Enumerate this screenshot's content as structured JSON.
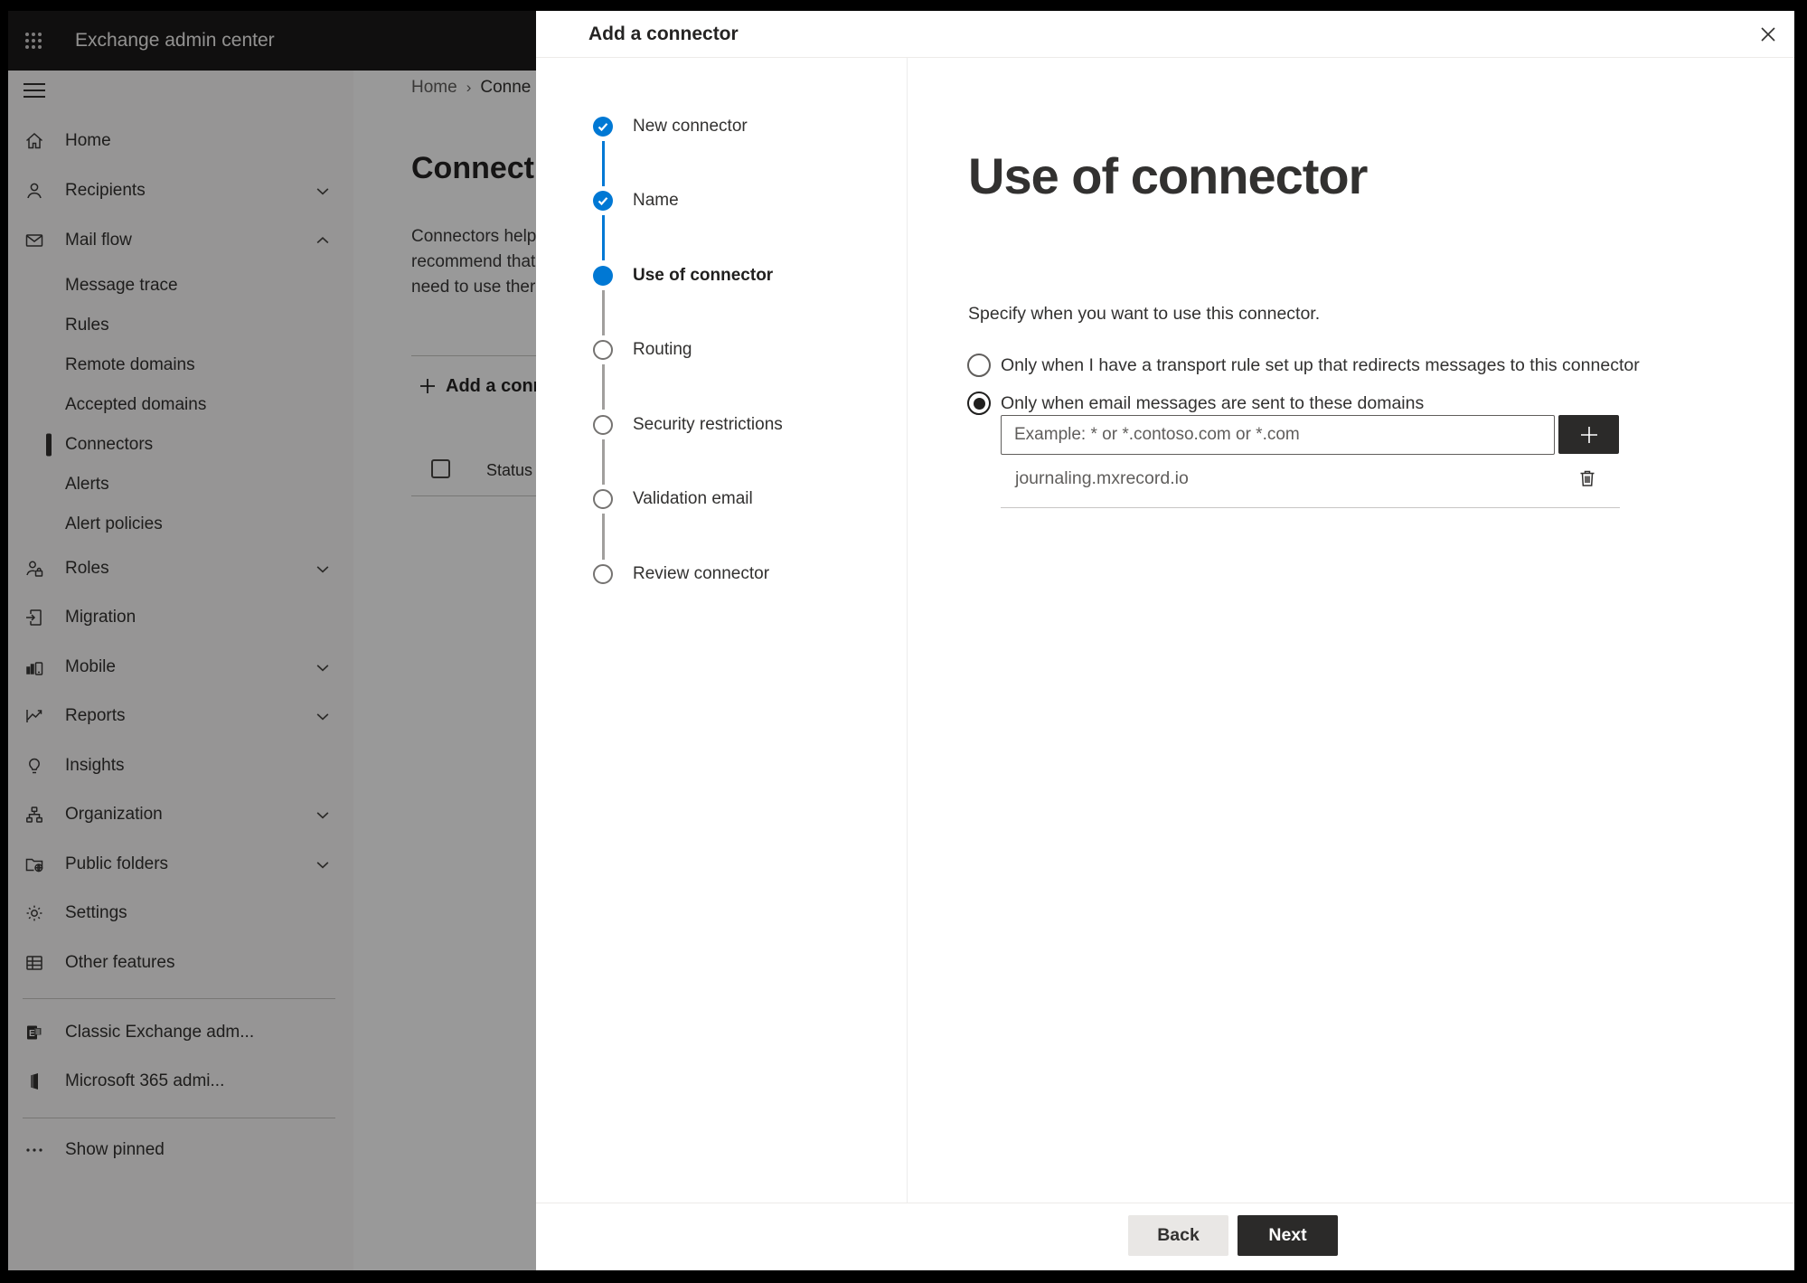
{
  "topbar": {
    "title": "Exchange admin center",
    "waffle_icon": "app-launcher-waffle-icon"
  },
  "sidebar": {
    "hamburger_icon": "hamburger-menu-icon",
    "items": [
      {
        "label": "Home",
        "icon": "home-icon",
        "type": "main"
      },
      {
        "label": "Recipients",
        "icon": "person-icon",
        "type": "main",
        "chevron": "down"
      },
      {
        "label": "Mail flow",
        "icon": "mail-icon",
        "type": "main",
        "chevron": "up",
        "expanded": true
      },
      {
        "label": "Message trace",
        "type": "sub"
      },
      {
        "label": "Rules",
        "type": "sub"
      },
      {
        "label": "Remote domains",
        "type": "sub"
      },
      {
        "label": "Accepted domains",
        "type": "sub"
      },
      {
        "label": "Connectors",
        "type": "sub",
        "selected": true
      },
      {
        "label": "Alerts",
        "type": "sub"
      },
      {
        "label": "Alert policies",
        "type": "sub"
      },
      {
        "label": "Roles",
        "icon": "roles-person-icon",
        "type": "main",
        "chevron": "down"
      },
      {
        "label": "Migration",
        "icon": "migration-icon",
        "type": "main"
      },
      {
        "label": "Mobile",
        "icon": "mobile-devices-icon",
        "type": "main",
        "chevron": "down"
      },
      {
        "label": "Reports",
        "icon": "reports-chart-icon",
        "type": "main",
        "chevron": "down"
      },
      {
        "label": "Insights",
        "icon": "lightbulb-icon",
        "type": "main"
      },
      {
        "label": "Organization",
        "icon": "org-chart-icon",
        "type": "main",
        "chevron": "down"
      },
      {
        "label": "Public folders",
        "icon": "folder-globe-icon",
        "type": "main",
        "chevron": "down"
      },
      {
        "label": "Settings",
        "icon": "gear-icon",
        "type": "main"
      },
      {
        "label": "Other features",
        "icon": "table-grid-icon",
        "type": "main"
      },
      {
        "label": "Classic Exchange adm...",
        "icon": "exchange-logo-icon",
        "type": "footer"
      },
      {
        "label": "Microsoft 365 admi...",
        "icon": "microsoft365-logo-icon",
        "type": "footer"
      },
      {
        "label": "Show pinned",
        "icon": "ellipsis-icon",
        "type": "footer"
      }
    ]
  },
  "background_page": {
    "breadcrumb": {
      "home": "Home",
      "separator": "›",
      "current": "Conne"
    },
    "heading": "Connect",
    "description_lines": [
      "Connectors help",
      "recommend that",
      "need to use ther"
    ],
    "add_button": "Add a conn",
    "status_header": "Status"
  },
  "wizard": {
    "title": "Add a connector",
    "close_icon": "close-icon",
    "steps": [
      {
        "label": "New connector",
        "state": "done"
      },
      {
        "label": "Name",
        "state": "done"
      },
      {
        "label": "Use of connector",
        "state": "current"
      },
      {
        "label": "Routing",
        "state": "todo"
      },
      {
        "label": "Security restrictions",
        "state": "todo"
      },
      {
        "label": "Validation email",
        "state": "todo"
      },
      {
        "label": "Review connector",
        "state": "todo"
      }
    ]
  },
  "panel": {
    "heading": "Use of connector",
    "instruction": "Specify when you want to use this connector.",
    "options": [
      {
        "label": "Only when I have a transport rule set up that redirects messages to this connector",
        "selected": false
      },
      {
        "label": "Only when email messages are sent to these domains",
        "selected": true
      }
    ],
    "domain_input": {
      "placeholder": "Example: * or *.contoso.com or *.com",
      "add_icon": "plus-icon"
    },
    "domains": [
      {
        "value": "journaling.mxrecord.io",
        "delete_icon": "trash-icon"
      }
    ]
  },
  "footer": {
    "back": "Back",
    "next": "Next"
  },
  "colors": {
    "accent_blue": "#0078d4",
    "topbar_bg": "#1b1a19",
    "dark_button": "#2b2a29",
    "overlay": "rgba(0,0,0,0.40)"
  }
}
